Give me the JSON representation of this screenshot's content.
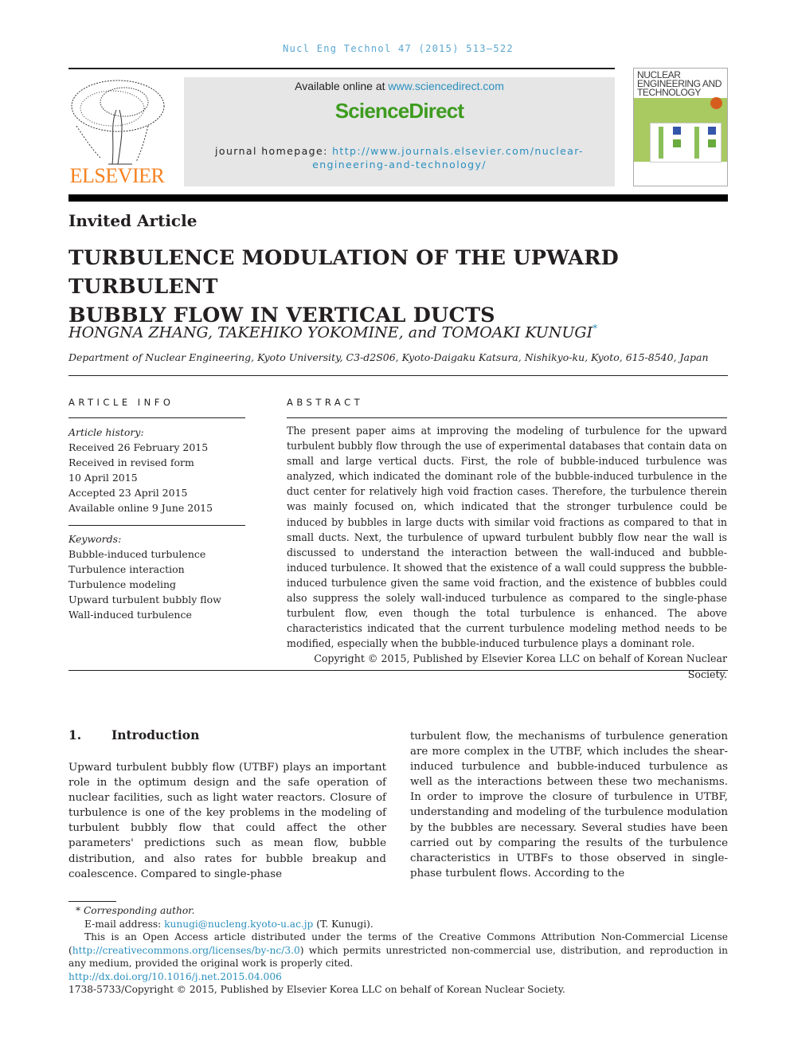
{
  "journal_ref": "Nucl Eng Technol 47 (2015) 513–522",
  "header": {
    "available_prefix": "Available online at ",
    "available_link": "www.sciencedirect.com",
    "brand": "ScienceDirect",
    "homepage_prefix": "journal homepage: ",
    "homepage_link_1": "http://www.journals.elsevier.com/nuclear-",
    "homepage_link_2": "engineering-and-technology/",
    "publisher_logo": "ELSEVIER",
    "cover_title": "NUCLEAR ENGINEERING AND TECHNOLOGY",
    "brand_color": "#3e9c1f",
    "elsevier_color": "#f58220",
    "link_color": "#2a8fbd"
  },
  "article_type": "Invited Article",
  "title_line1": "TURBULENCE MODULATION OF THE UPWARD TURBULENT",
  "title_line2": "BUBBLY FLOW IN VERTICAL DUCTS",
  "authors": "HONGNA ZHANG, TAKEHIKO YOKOMINE, and TOMOAKI KUNUGI",
  "author_mark": "*",
  "affiliation": "Department of Nuclear Engineering, Kyoto University, C3-d2S06, Kyoto-Daigaku Katsura, Nishikyo-ku, Kyoto, 615-8540, Japan",
  "article_info": {
    "heading": "ARTICLE INFO",
    "history_label": "Article history:",
    "history": [
      "Received 26 February 2015",
      "Received in revised form",
      "10 April 2015",
      "Accepted 23 April 2015",
      "Available online 9 June 2015"
    ],
    "keywords_label": "Keywords:",
    "keywords": [
      "Bubble-induced turbulence",
      "Turbulence interaction",
      "Turbulence modeling",
      "Upward turbulent bubbly flow",
      "Wall-induced turbulence"
    ]
  },
  "abstract": {
    "heading": "ABSTRACT",
    "text": "The present paper aims at improving the modeling of turbulence for the upward turbulent bubbly flow through the use of experimental databases that contain data on small and large vertical ducts. First, the role of bubble-induced turbulence was analyzed, which indicated the dominant role of the bubble-induced turbulence in the duct center for relatively high void fraction cases. Therefore, the turbulence therein was mainly focused on, which indicated that the stronger turbulence could be induced by bubbles in large ducts with similar void fractions as compared to that in small ducts. Next, the turbulence of upward turbulent bubbly flow near the wall is discussed to understand the interaction between the wall-induced and bubble-induced turbulence. It showed that the existence of a wall could suppress the bubble-induced turbulence given the same void fraction, and the existence of bubbles could also suppress the solely wall-induced turbulence as compared to the single-phase turbulent flow, even though the total turbulence is enhanced. The above characteristics indicated that the current turbulence modeling method needs to be modified, especially when the bubble-induced turbulence plays a dominant role.",
    "copyright": "Copyright © 2015, Published by Elsevier Korea LLC on behalf of Korean Nuclear Society."
  },
  "intro": {
    "number": "1.",
    "heading": "Introduction",
    "left": "Upward turbulent bubbly flow (UTBF) plays an important role in the optimum design and the safe operation of nuclear facilities, such as light water reactors. Closure of turbulence is one of the key problems in the modeling of turbulent bubbly flow that could affect the other parameters' predictions such as mean flow, bubble distribution, and also rates for bubble breakup and coalescence. Compared to single-phase",
    "right": "turbulent flow, the mechanisms of turbulence generation are more complex in the UTBF, which includes the shear-induced turbulence and bubble-induced turbulence as well as the interactions between these two mechanisms. In order to improve the closure of turbulence in UTBF, understanding and modeling of the turbulence modulation by the bubbles are necessary. Several studies have been carried out by comparing the results of the turbulence characteristics in UTBFs to those observed in single-phase turbulent flows. According to the"
  },
  "footnotes": {
    "corr_mark": "*",
    "corr": "Corresponding author.",
    "email_label": "E-mail address: ",
    "email": "kunugi@nucleng.kyoto-u.ac.jp",
    "email_suffix": " (T. Kunugi).",
    "license_pre": "This is an Open Access article distributed under the terms of the Creative Commons Attribution Non-Commercial License (",
    "license_link": "http://creativecommons.org/licenses/by-nc/3.0",
    "license_post": ") which permits unrestricted non-commercial use, distribution, and reproduction in any medium, provided the original work is properly cited.",
    "doi": "http://dx.doi.org/10.1016/j.net.2015.04.006",
    "issn": "1738-5733/Copyright © 2015, Published by Elsevier Korea LLC on behalf of Korean Nuclear Society."
  }
}
